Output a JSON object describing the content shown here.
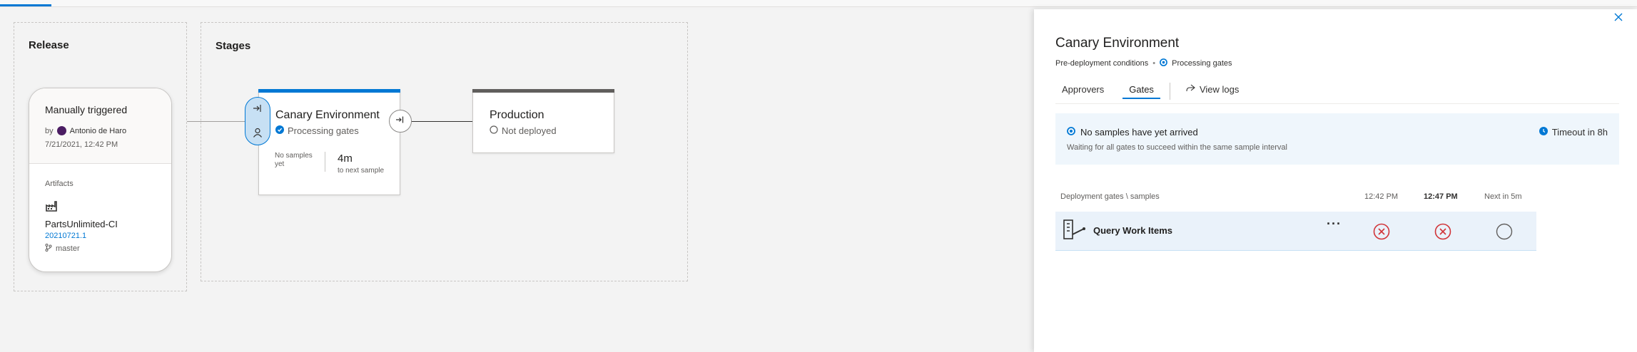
{
  "release": {
    "title": "Release",
    "trigger": "Manually triggered",
    "by_prefix": "by",
    "by_name": "Antonio de Haro",
    "date": "7/21/2021, 12:42 PM",
    "artifacts_label": "Artifacts",
    "artifact_name": "PartsUnlimited-CI",
    "artifact_build": "20210721.1",
    "artifact_branch": "master"
  },
  "stages": {
    "title": "Stages",
    "canary": {
      "name": "Canary Environment",
      "status": "Processing gates",
      "samples_text": "No samples yet",
      "next_value": "4m",
      "next_label": "to next sample"
    },
    "production": {
      "name": "Production",
      "status": "Not deployed"
    }
  },
  "panel": {
    "title": "Canary Environment",
    "subtitle": "Pre-deployment conditions",
    "subtitle_sep": "•",
    "subtitle_status": "Processing gates",
    "tabs": [
      {
        "label": "Approvers",
        "active": false
      },
      {
        "label": "Gates",
        "active": true
      }
    ],
    "view_logs": "View logs",
    "banner": {
      "title": "No samples have yet arrived",
      "subtitle": "Waiting for all gates to succeed within the same sample interval",
      "timeout": "Timeout in 8h"
    },
    "grid": {
      "header_label": "Deployment gates \\ samples",
      "columns": [
        "12:42 PM",
        "12:47 PM",
        "Next in 5m"
      ],
      "rows": [
        {
          "name": "Query Work Items",
          "samples": [
            "failed",
            "failed",
            "pending"
          ]
        }
      ]
    }
  },
  "colors": {
    "accent": "#0078d4",
    "error": "#d13438",
    "production_bar": "#605e5c"
  }
}
